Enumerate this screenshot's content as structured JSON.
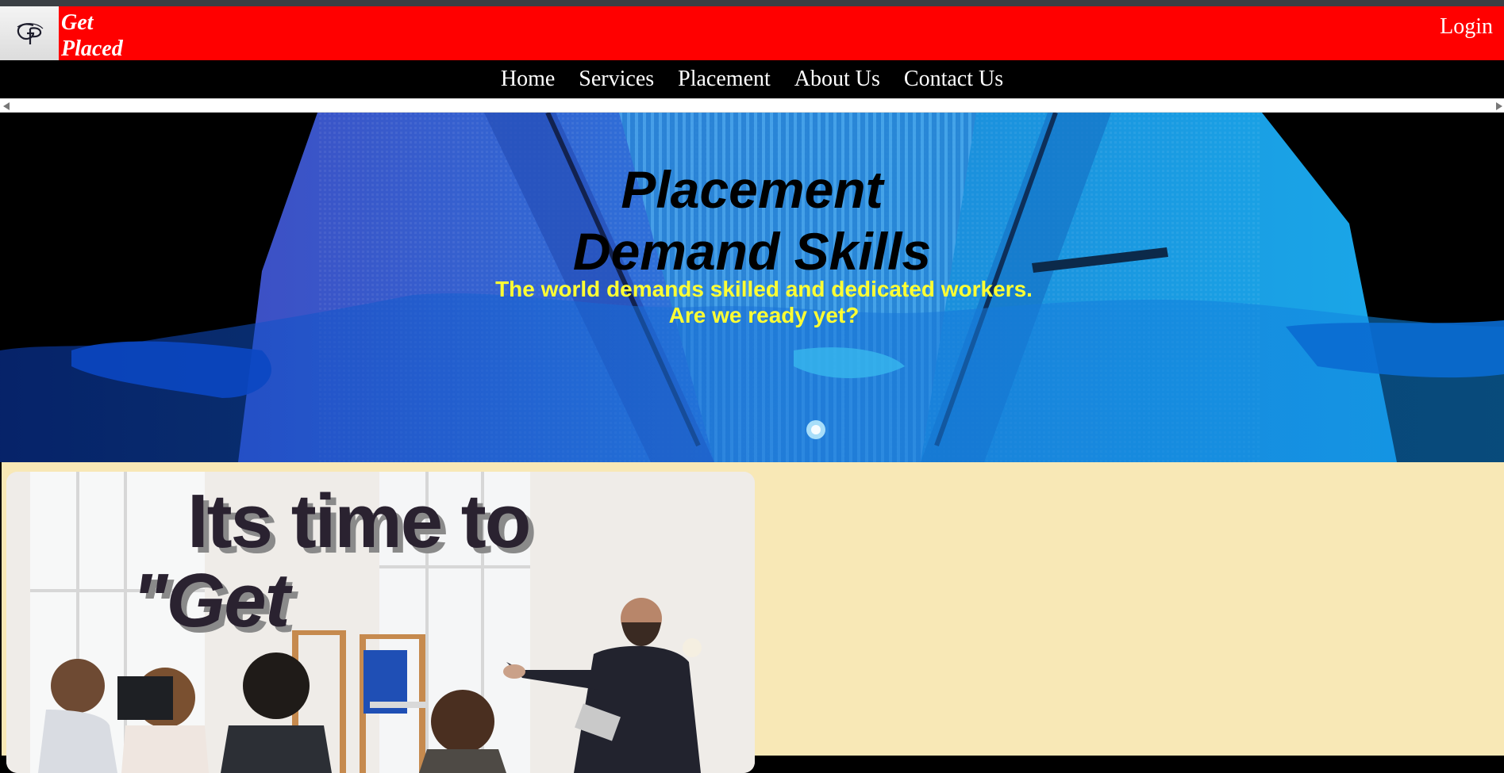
{
  "brand": {
    "line1": "Get",
    "line2": "Placed",
    "logo_icon": "gp-monogram-icon"
  },
  "header": {
    "login_label": "Login"
  },
  "nav": {
    "items": [
      {
        "label": "Home"
      },
      {
        "label": "Services"
      },
      {
        "label": "Placement"
      },
      {
        "label": "About Us"
      },
      {
        "label": "Contact Us"
      }
    ]
  },
  "hero": {
    "title_line1": "Placement",
    "title_line2": "Demand Skills",
    "subtitle_line1": "The world demands skilled and dedicated workers.",
    "subtitle_line2": "Are we ready yet?"
  },
  "promo": {
    "line1": "Its time to",
    "line2": "\"Get"
  },
  "colors": {
    "header_bg": "#ff0000",
    "nav_bg": "#000000",
    "subtitle": "#ffff33",
    "content_bg": "#f8e8b6"
  }
}
